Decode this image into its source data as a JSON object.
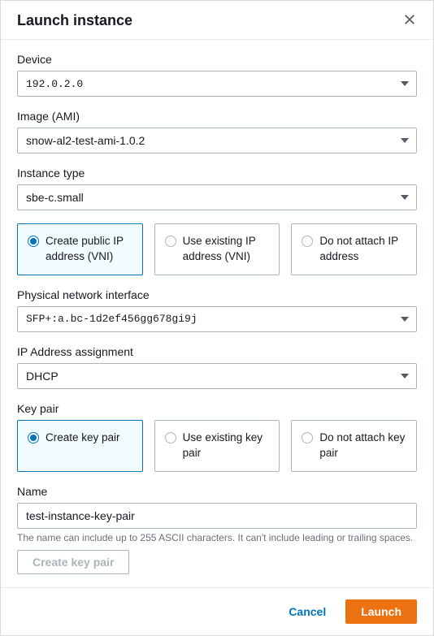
{
  "modal": {
    "title": "Launch instance"
  },
  "fields": {
    "device": {
      "label": "Device",
      "value": "192.0.2.0"
    },
    "image": {
      "label": "Image (AMI)",
      "value": "snow-al2-test-ami-1.0.2"
    },
    "instanceType": {
      "label": "Instance type",
      "value": "sbe-c.small"
    },
    "ipRadio": {
      "options": [
        "Create public IP address (VNI)",
        "Use existing IP address (VNI)",
        "Do not attach IP address"
      ]
    },
    "pni": {
      "label": "Physical network interface",
      "value": "SFP+:a.bc-1d2ef456gg678gi9j"
    },
    "ipAssign": {
      "label": "IP Address assignment",
      "value": "DHCP"
    },
    "keyPair": {
      "label": "Key pair",
      "options": [
        "Create key pair",
        "Use existing key pair",
        "Do not attach key pair"
      ]
    },
    "name": {
      "label": "Name",
      "value": "test-instance-key-pair",
      "hint": "The name can include up to 255 ASCII characters. It can't include leading or trailing spaces."
    }
  },
  "buttons": {
    "createKeyPair": "Create key pair",
    "cancel": "Cancel",
    "launch": "Launch"
  }
}
